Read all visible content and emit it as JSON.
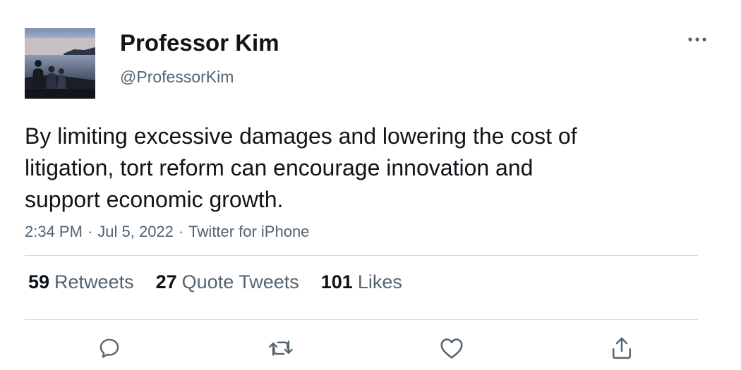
{
  "author": {
    "display_name": "Professor Kim",
    "handle": "@ProfessorKim",
    "avatar_icon": "avatar-photo-lakeside"
  },
  "menu": {
    "icon": "more-horizontal-icon"
  },
  "tweet": {
    "text_lines": [
      "By limiting excessive damages and lowering the cost of",
      "litigation, tort reform can encourage innovation and",
      "support economic growth."
    ],
    "time": "2:34 PM",
    "date": "Jul 5, 2022",
    "source": "Twitter for iPhone",
    "separator": "·"
  },
  "stats": {
    "retweets": {
      "count": "59",
      "label": "Retweets"
    },
    "quotes": {
      "count": "27",
      "label": "Quote Tweets"
    },
    "likes": {
      "count": "101",
      "label": "Likes"
    }
  },
  "actions": [
    {
      "name": "reply",
      "icon": "reply-icon"
    },
    {
      "name": "retweet",
      "icon": "retweet-icon"
    },
    {
      "name": "like",
      "icon": "heart-icon"
    },
    {
      "name": "share",
      "icon": "share-icon"
    }
  ],
  "colors": {
    "text_primary": "#0f1419",
    "text_secondary": "#536471",
    "divider": "#cfd9de"
  }
}
